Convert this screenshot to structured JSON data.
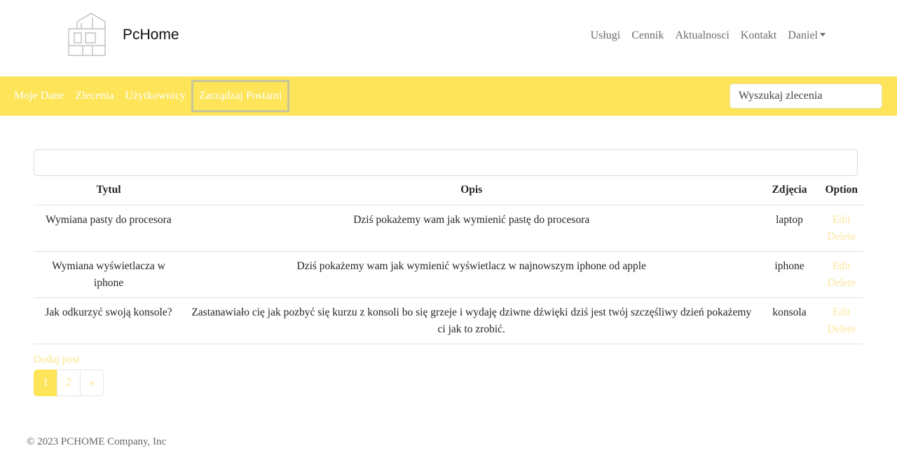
{
  "header": {
    "brand": "PcHome",
    "nav": [
      "Usługi",
      "Cennik",
      "Aktualnosci",
      "Kontakt"
    ],
    "user": "Daniel"
  },
  "subnav": {
    "links": [
      "Moje Dane",
      "Zlecenia",
      "Użytkownicy",
      "Zarządzaj Postami"
    ],
    "active_index": 3,
    "search_placeholder": "Wyszukaj zlecenia"
  },
  "table": {
    "headers": [
      "Tytul",
      "Opis",
      "Zdjęcia",
      "Option"
    ],
    "rows": [
      {
        "title": "Wymiana pasty do procesora",
        "desc": "Dziś pokażemy wam jak wymienić pastę do procesora",
        "img": "laptop"
      },
      {
        "title": "Wymiana wyświetlacza w iphone",
        "desc": "Dziś pokażemy wam jak wymienić wyświetlacz w najnowszym iphone od apple",
        "img": "iphone"
      },
      {
        "title": "Jak odkurzyć swoją konsole?",
        "desc": "Zastanawiało cię jak pozbyć się kurzu z konsoli bo się grzeje i wydaję dziwne dźwięki dziś jest twój szczęśliwy dzień pokażemy ci jak to zrobić.",
        "img": "konsola"
      }
    ],
    "edit_label": "Edit",
    "delete_label": "Delete"
  },
  "add_post_label": "Dodaj post",
  "pagination": [
    "1",
    "2",
    "»"
  ],
  "footer": "© 2023 PCHOME Company, Inc",
  "colors": {
    "accent": "#fde458"
  }
}
